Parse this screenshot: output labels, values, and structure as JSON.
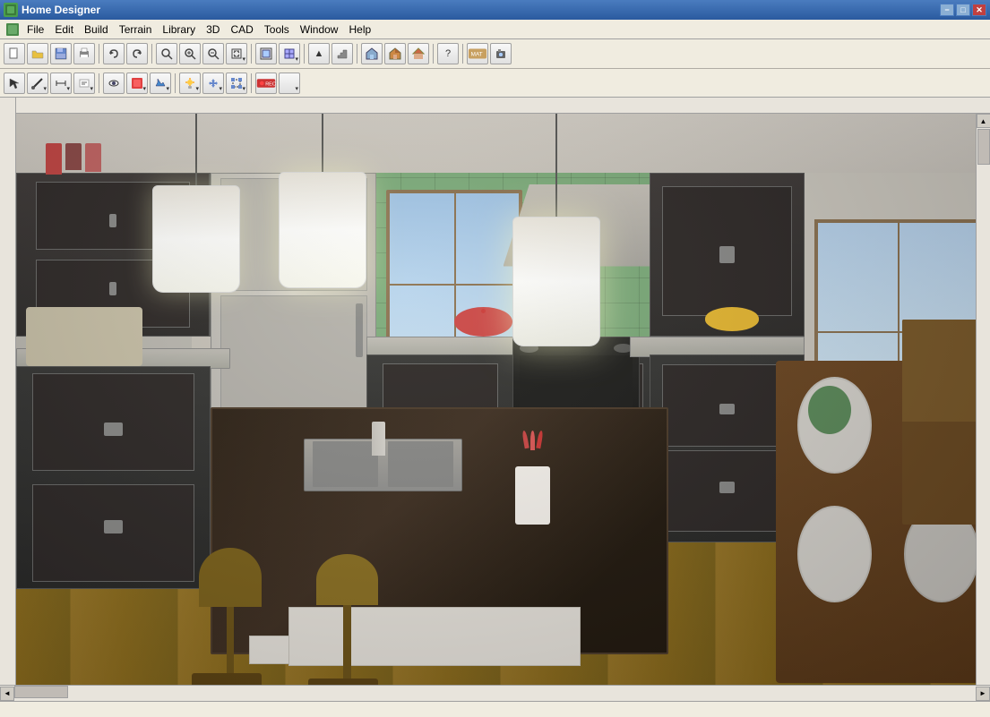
{
  "window": {
    "title": "Home Designer",
    "icon": "HD"
  },
  "titlebar": {
    "min": "−",
    "max": "□",
    "close": "✕"
  },
  "menu": {
    "items": [
      "File",
      "Edit",
      "Build",
      "Terrain",
      "Library",
      "3D",
      "CAD",
      "Tools",
      "Window",
      "Help"
    ]
  },
  "toolbar1": {
    "buttons": [
      {
        "name": "new",
        "icon": "□",
        "tooltip": "New"
      },
      {
        "name": "open",
        "icon": "📁",
        "tooltip": "Open"
      },
      {
        "name": "save",
        "icon": "💾",
        "tooltip": "Save"
      },
      {
        "name": "print",
        "icon": "🖨",
        "tooltip": "Print"
      },
      {
        "name": "undo",
        "icon": "↩",
        "tooltip": "Undo"
      },
      {
        "name": "redo",
        "icon": "↪",
        "tooltip": "Redo"
      },
      {
        "name": "search",
        "icon": "🔍",
        "tooltip": "Search"
      },
      {
        "name": "zoom-in",
        "icon": "⊕",
        "tooltip": "Zoom In"
      },
      {
        "name": "zoom-out",
        "icon": "⊖",
        "tooltip": "Zoom Out"
      }
    ]
  },
  "toolbar2": {
    "buttons": [
      {
        "name": "select",
        "icon": "↖",
        "tooltip": "Select"
      },
      {
        "name": "draw",
        "icon": "✏",
        "tooltip": "Draw"
      },
      {
        "name": "dimension",
        "icon": "⟺",
        "tooltip": "Dimension"
      },
      {
        "name": "text",
        "icon": "T",
        "tooltip": "Text"
      },
      {
        "name": "camera",
        "icon": "📷",
        "tooltip": "Camera"
      }
    ]
  },
  "statusbar": {
    "text": ""
  },
  "scene": {
    "description": "3D Kitchen Design View"
  }
}
